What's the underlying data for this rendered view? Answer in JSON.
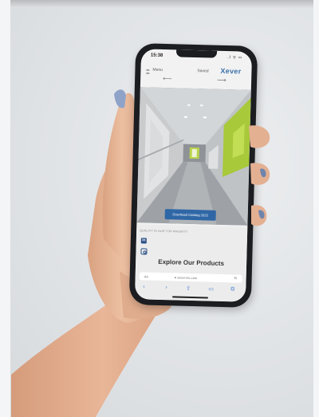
{
  "phone": {
    "status": {
      "time": "15:38",
      "signal": "..l ᯤ ▭"
    },
    "nav": {
      "menu_label": "Menu",
      "saved_label": "Saved",
      "logo_text": "Xever"
    },
    "arrows": {
      "left": "⟵",
      "right": "⟶"
    },
    "cta_label": "Download Catalog 2022",
    "tagline": "QUALITY IS OUR TOP PRIORITY",
    "linkedin_glyph": "in",
    "heading": "Explore Our Products",
    "browser": {
      "aa": "AA",
      "url": "● xever-etc.com",
      "reload": "↻"
    },
    "toolbar": {
      "back": "‹",
      "forward": "›",
      "share": "⇧",
      "bookmarks": "▭",
      "tabs": "⧉"
    }
  },
  "colors": {
    "background": "#e3e5e7",
    "phone_body": "#1b1d20",
    "accent_blue": "#2f67a6",
    "lime_wall": "#a8c93a",
    "skin": "#e8b99a",
    "nail": "#8fa3c9"
  }
}
